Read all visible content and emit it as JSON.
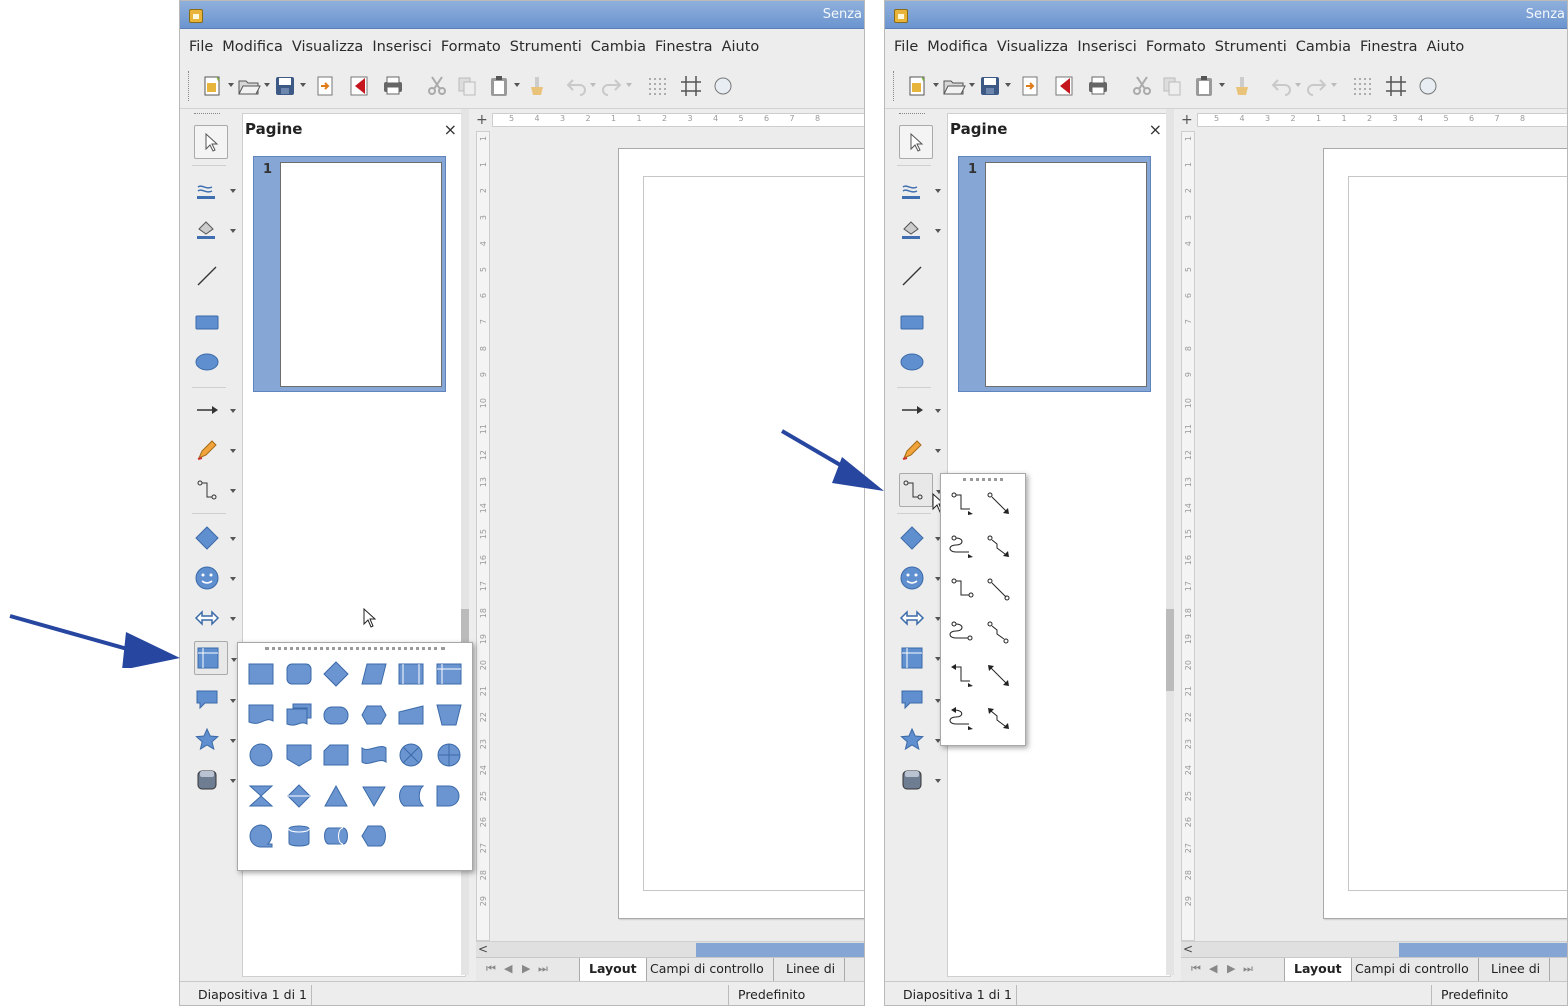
{
  "window": {
    "title": "Senza"
  },
  "menu": [
    "File",
    "Modifica",
    "Visualizza",
    "Inserisci",
    "Formato",
    "Strumenti",
    "Cambia",
    "Finestra",
    "Aiuto"
  ],
  "toolbar_icons": [
    "new-icon",
    "open-icon",
    "save-icon",
    "import-icon",
    "export-pdf-icon",
    "print-icon",
    "cut-icon",
    "copy-icon",
    "paste-icon",
    "clone-formatting-icon",
    "undo-icon",
    "redo-icon",
    "grid-icon",
    "helplines-icon",
    "zoom-icon"
  ],
  "sidebar_tools": [
    "select-icon",
    "line-color-icon",
    "fill-color-icon",
    "line-icon",
    "rectangle-icon",
    "ellipse-icon",
    "arrow-line-icon",
    "freeform-pencil-icon",
    "connector-icon",
    "diamond-basic-shapes-icon",
    "smiley-symbol-shapes-icon",
    "double-arrow-block-icon",
    "flowchart-icon",
    "callout-icon",
    "star-icon",
    "3d-object-icon"
  ],
  "pages_panel": {
    "title": "Pagine",
    "close": "×",
    "page_number": "1"
  },
  "tabs": [
    "Layout",
    "Campi di controllo",
    "Linee di"
  ],
  "statusbar": {
    "slide": "Diapositiva 1 di 1",
    "layout": "Predefinito"
  },
  "ruler_h": [
    "5",
    "4",
    "3",
    "2",
    "1",
    "1",
    "2",
    "3",
    "4",
    "5",
    "6",
    "7",
    "8"
  ],
  "ruler_v": [
    "1",
    "1",
    "2",
    "3",
    "4",
    "5",
    "6",
    "7",
    "8",
    "9",
    "10",
    "11",
    "12",
    "13",
    "14",
    "15",
    "16",
    "17",
    "18",
    "19",
    "20",
    "21",
    "22",
    "23",
    "24",
    "25",
    "26",
    "27",
    "28",
    "29"
  ],
  "flowchart_popup": {
    "rows": [
      [
        "process",
        "alternate-process",
        "decision",
        "data",
        "predefined-process",
        "internal-storage"
      ],
      [
        "document",
        "multidocument",
        "terminator",
        "preparation",
        "manual-input",
        "manual-operation"
      ],
      [
        "connector",
        "off-page-connector",
        "card",
        "punched-tape",
        "summing-junction",
        "or"
      ],
      [
        "collate",
        "sort",
        "extract",
        "merge",
        "stored-data",
        "delay"
      ],
      [
        "sequential-access",
        "magnetic-disc",
        "direct-access-storage",
        "display"
      ]
    ]
  },
  "connector_popup": {
    "rows": [
      [
        "connector-ends-with-arrow",
        "straight-connector-ends-with-arrow"
      ],
      [
        "curved-connector-ends-with-arrow",
        "line-connector-ends-with-arrow"
      ],
      [
        "connector",
        "straight-connector"
      ],
      [
        "curved-connector",
        "line-connector"
      ],
      [
        "connector-with-arrows",
        "straight-connector-with-arrows"
      ],
      [
        "curved-connector-with-arrows",
        "line-connector-with-arrows"
      ]
    ]
  },
  "accent_color": "#6b94cf",
  "shape_color": "#6b95d1",
  "annotation_arrow_color": "#2746a0"
}
